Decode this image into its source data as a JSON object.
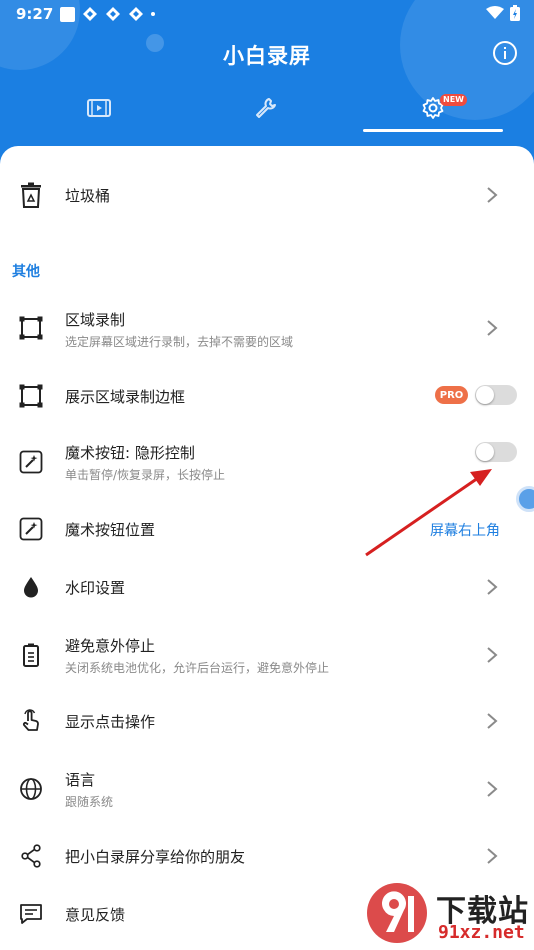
{
  "status_bar": {
    "time": "9:27"
  },
  "header": {
    "title": "小白录屏",
    "tabs": [
      "video",
      "tools",
      "settings"
    ],
    "new_badge": "NEW"
  },
  "colors": {
    "primary": "#1b7fe2",
    "accent_text": "#1f7fe0",
    "pro_badge": "#ee7048",
    "annotation_arrow": "#d62020"
  },
  "settings": {
    "trash": {
      "title": "垃圾桶",
      "icon": "trash-icon"
    },
    "section_other": "其他",
    "region_record": {
      "title": "区域录制",
      "subtitle": "选定屏幕区域进行录制，去掉不需要的区域"
    },
    "region_border": {
      "title": "展示区域录制边框",
      "badge": "PRO",
      "enabled": false
    },
    "magic_button": {
      "title": "魔术按钮: 隐形控制",
      "subtitle": "单击暂停/恢复录屏，长按停止",
      "enabled": false
    },
    "magic_position": {
      "title": "魔术按钮位置",
      "value": "屏幕右上角"
    },
    "watermark": {
      "title": "水印设置"
    },
    "avoid_stop": {
      "title": "避免意外停止",
      "subtitle": "关闭系统电池优化，允许后台运行，避免意外停止"
    },
    "show_touches": {
      "title": "显示点击操作"
    },
    "language": {
      "title": "语言",
      "subtitle": "跟随系统"
    },
    "share": {
      "title": "把小白录屏分享给你的朋友"
    },
    "feedback": {
      "title": "意见反馈"
    }
  },
  "watermark_overlay": {
    "line1": "下载站",
    "line2": "91xz.net"
  }
}
